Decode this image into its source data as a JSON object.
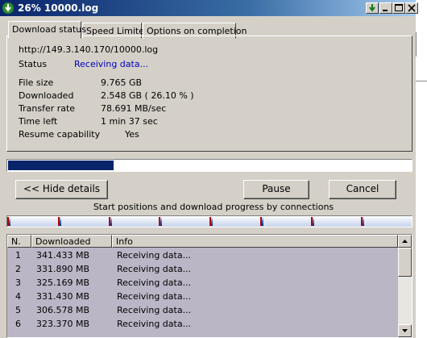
{
  "window": {
    "title": "26% 10000.log"
  },
  "tabs": [
    "Download status",
    "Speed Limiter",
    "Options on completion"
  ],
  "status": {
    "url": "http://149.3.140.170/10000.log",
    "status_label": "Status",
    "status_value": "Receiving data...",
    "fields": [
      {
        "label": "File size",
        "value": "9.765  GB"
      },
      {
        "label": "Downloaded",
        "value": "2.548  GB  ( 26.10 % )"
      },
      {
        "label": "Transfer rate",
        "value": "78.691  MB/sec"
      },
      {
        "label": "Time left",
        "value": "1 min 37 sec"
      },
      {
        "label": "Resume capability",
        "value": "Yes"
      }
    ]
  },
  "progress": {
    "percent": 26.1
  },
  "buttons": {
    "hide_details": "<< Hide details",
    "pause": "Pause",
    "cancel": "Cancel"
  },
  "connections_caption": "Start positions and download progress by connections",
  "connections": {
    "count": 8,
    "progress_fraction": 0.26
  },
  "table": {
    "headers": [
      "N.",
      "Downloaded",
      "Info"
    ],
    "rows": [
      {
        "n": "1",
        "downloaded": "341.433  MB",
        "info": "Receiving data..."
      },
      {
        "n": "2",
        "downloaded": "331.890  MB",
        "info": "Receiving data..."
      },
      {
        "n": "3",
        "downloaded": "325.169  MB",
        "info": "Receiving data..."
      },
      {
        "n": "4",
        "downloaded": "331.430  MB",
        "info": "Receiving data..."
      },
      {
        "n": "5",
        "downloaded": "306.578  MB",
        "info": "Receiving data..."
      },
      {
        "n": "6",
        "downloaded": "323.370  MB",
        "info": "Receiving data..."
      }
    ]
  },
  "colors": {
    "title_bar": "#0a246a",
    "progress": "#0a246a",
    "status_link": "#0000c0",
    "table_bg": "#bab6c6"
  }
}
